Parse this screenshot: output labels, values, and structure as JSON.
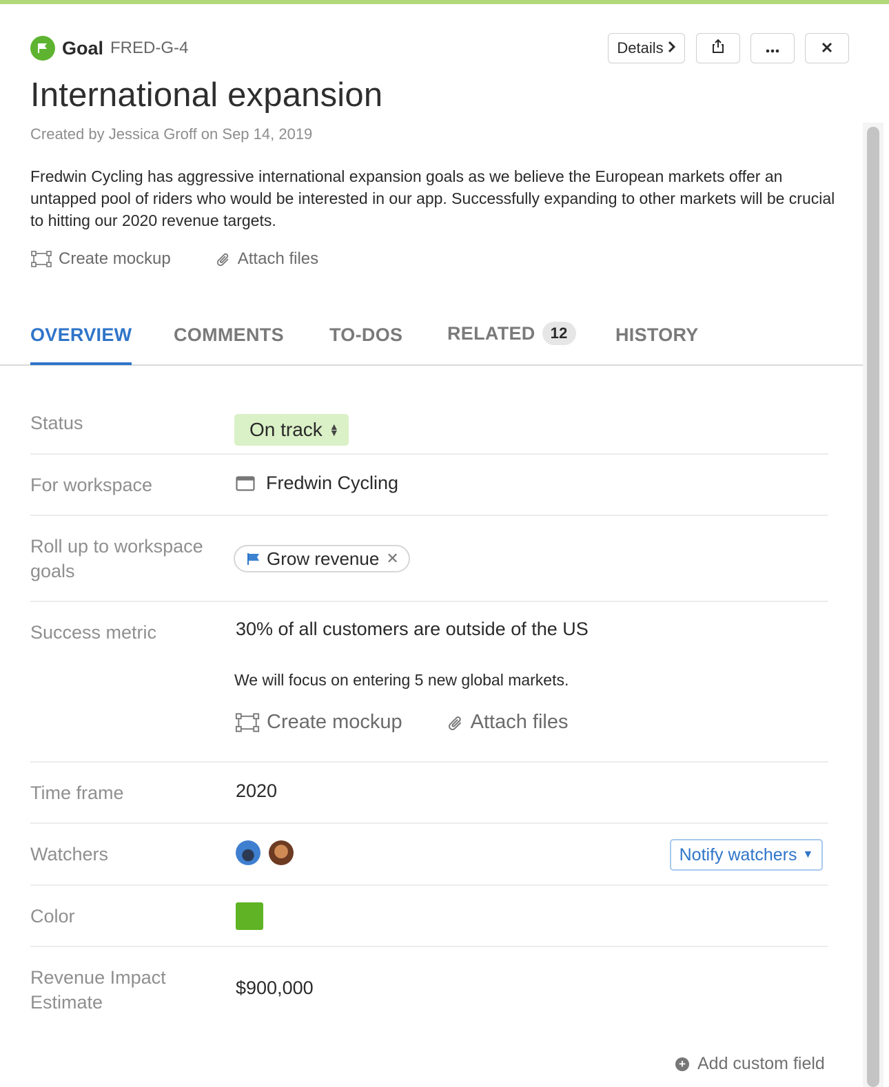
{
  "accent_color": "#b3d87a",
  "header": {
    "type_label": "Goal",
    "key": "FRED-G-4",
    "details_label": "Details",
    "icons": [
      "flag-icon",
      "share-icon",
      "more-icon",
      "close-icon"
    ]
  },
  "title": "International expansion",
  "created": "Created by Jessica Groff on Sep 14, 2019",
  "description": "Fredwin Cycling has aggressive international expansion goals as we believe the European markets offer an untapped pool of riders who would be interested in our app. Successfully expanding to other markets will be crucial to hitting our 2020 revenue targets.",
  "actions": {
    "create_mockup": "Create mockup",
    "attach_files": "Attach files"
  },
  "tabs": [
    {
      "label": "OVERVIEW",
      "active": true
    },
    {
      "label": "COMMENTS"
    },
    {
      "label": "TO-DOS"
    },
    {
      "label": "RELATED",
      "badge": "12"
    },
    {
      "label": "HISTORY"
    }
  ],
  "fields": {
    "status": {
      "label": "Status",
      "value": "On track",
      "color": "#daf0c6"
    },
    "workspace": {
      "label": "For workspace",
      "value": "Fredwin Cycling"
    },
    "rollup": {
      "label": "Roll up to workspace goals",
      "value": "Grow revenue"
    },
    "metric": {
      "label": "Success metric",
      "value": "30% of all customers are outside of the US",
      "note": "We will focus on entering 5 new global markets."
    },
    "timeframe": {
      "label": "Time frame",
      "value": "2020"
    },
    "watchers": {
      "label": "Watchers",
      "notify_label": "Notify watchers",
      "count": 2
    },
    "color": {
      "label": "Color",
      "value": "#5fb324"
    },
    "revenue": {
      "label": "Revenue Impact Estimate",
      "value": "$900,000"
    }
  },
  "add_custom_field": "Add custom field"
}
